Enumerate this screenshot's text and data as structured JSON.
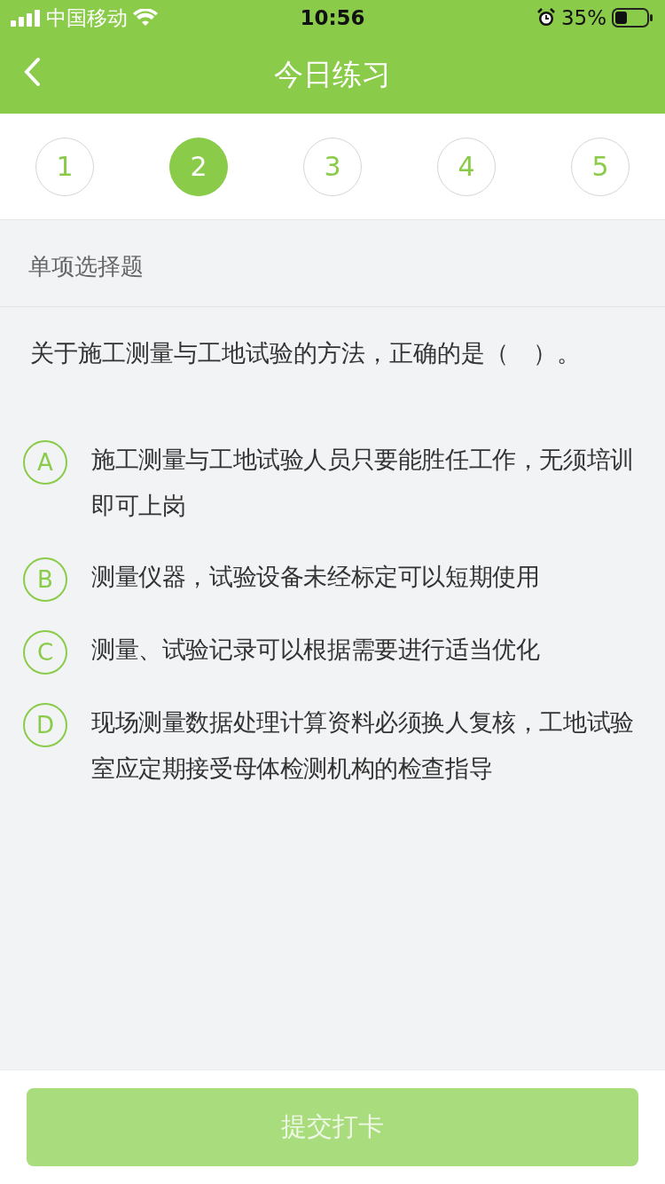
{
  "status_bar": {
    "carrier": "中国移动",
    "time": "10:56",
    "battery": "35%"
  },
  "nav": {
    "title": "今日练习"
  },
  "question_tabs": [
    {
      "label": "1",
      "selected": false
    },
    {
      "label": "2",
      "selected": true
    },
    {
      "label": "3",
      "selected": false
    },
    {
      "label": "4",
      "selected": false
    },
    {
      "label": "5",
      "selected": false
    }
  ],
  "question_type": "单项选择题",
  "question": "关于施工测量与工地试验的方法，正确的是（　）。",
  "options": [
    {
      "letter": "A",
      "text": "施工测量与工地试验人员只要能胜任工作，无须培训即可上岗",
      "selected": false
    },
    {
      "letter": "B",
      "text": "测量仪器，试验设备未经标定可以短期使用",
      "selected": false
    },
    {
      "letter": "C",
      "text": "测量、试验记录可以根据需要进行适当优化",
      "selected": false
    },
    {
      "letter": "D",
      "text": "现场测量数据处理计算资料必须换人复核，工地试验室应定期接受母体检测机构的检查指导",
      "selected": false
    }
  ],
  "submit": {
    "label": "提交打卡",
    "disabled": true
  }
}
